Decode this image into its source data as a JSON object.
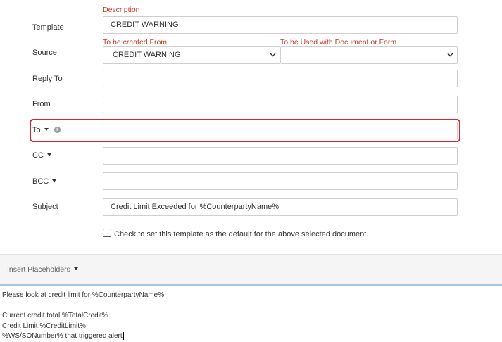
{
  "form": {
    "description_label": "Description",
    "template_label": "Template",
    "template_value": "CREDIT WARNING",
    "created_from_label": "To be created From",
    "used_with_label": "To be Used with Document or Form",
    "source_label": "Source",
    "source_value": "CREDIT WARNING",
    "used_with_value": "",
    "reply_to_label": "Reply To",
    "reply_to_value": "",
    "from_label": "From",
    "from_value": "",
    "to_label": "To",
    "to_value": "",
    "cc_label": "CC",
    "cc_value": "",
    "bcc_label": "BCC",
    "bcc_value": "",
    "subject_label": "Subject",
    "subject_value": "Credit Limit Exceeded for %CounterpartyName%",
    "default_checkbox_label": "Check to set this template as the default for the above selected document.",
    "default_checked": false
  },
  "toolbar": {
    "insert_placeholders_label": "Insert Placeholders"
  },
  "editor": {
    "lines": [
      "Please look at credit limit for %CounterpartyName%",
      "",
      "Current credit total %TotalCredit%",
      "Credit Limit %CreditLimit%",
      "%WS/SONumber% that triggered alert"
    ]
  },
  "colors": {
    "highlight": "#d9232d",
    "red_label": "#c0392b",
    "field_border": "#cfcfcf"
  }
}
